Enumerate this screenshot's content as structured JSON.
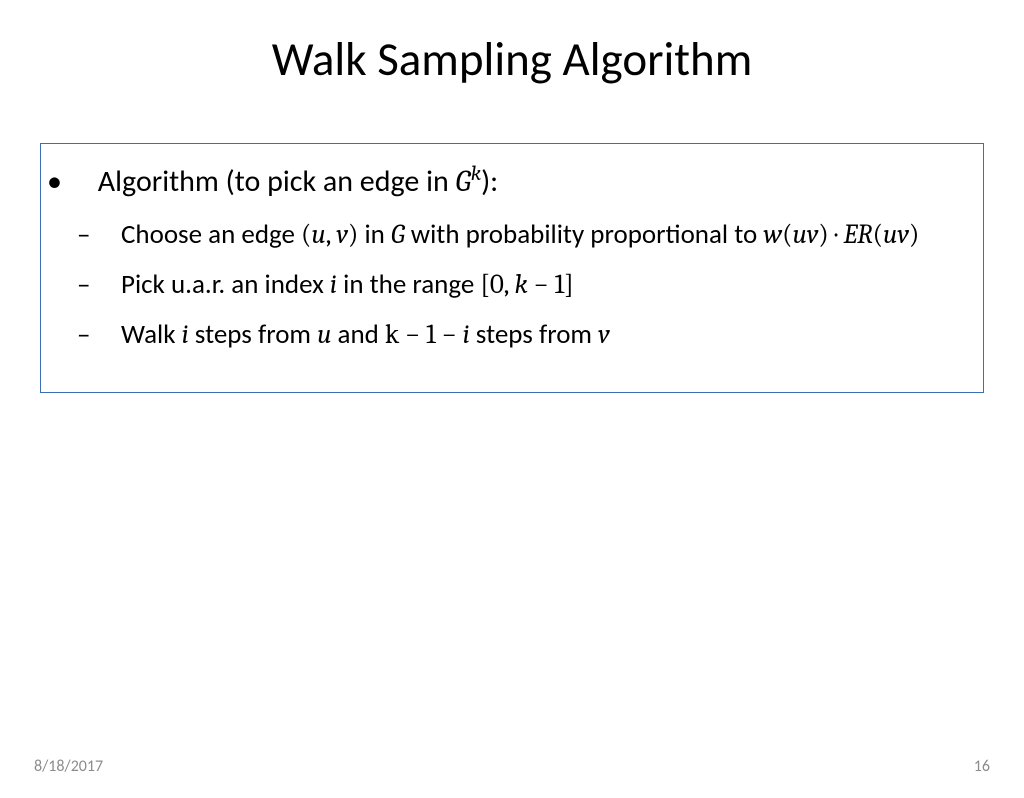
{
  "title": "Walk Sampling Algorithm",
  "main_bullet": {
    "prefix": "Algorithm (to pick an edge in ",
    "math": "G",
    "sup": "k",
    "suffix": "):"
  },
  "sub_bullets": [
    {
      "parts": [
        {
          "t": "text",
          "v": "Choose an edge "
        },
        {
          "t": "mathn",
          "v": "("
        },
        {
          "t": "math",
          "v": "u"
        },
        {
          "t": "mathn",
          "v": ", "
        },
        {
          "t": "math",
          "v": "v"
        },
        {
          "t": "mathn",
          "v": ")"
        },
        {
          "t": "text",
          "v": " in "
        },
        {
          "t": "math",
          "v": "G"
        },
        {
          "t": "text",
          "v": " with probability proportional to "
        },
        {
          "t": "math",
          "v": "w"
        },
        {
          "t": "mathn",
          "v": "("
        },
        {
          "t": "math",
          "v": "uv"
        },
        {
          "t": "mathn",
          "v": ") · "
        },
        {
          "t": "math",
          "v": "ER"
        },
        {
          "t": "mathn",
          "v": "("
        },
        {
          "t": "math",
          "v": "uv"
        },
        {
          "t": "mathn",
          "v": ")"
        }
      ]
    },
    {
      "parts": [
        {
          "t": "text",
          "v": "Pick u.a.r. an index "
        },
        {
          "t": "math",
          "v": "i"
        },
        {
          "t": "text",
          "v": " in the range "
        },
        {
          "t": "mathn",
          "v": "[0, "
        },
        {
          "t": "math",
          "v": "k"
        },
        {
          "t": "mathn",
          "v": " − 1]"
        }
      ]
    },
    {
      "parts": [
        {
          "t": "text",
          "v": "Walk "
        },
        {
          "t": "math",
          "v": "i"
        },
        {
          "t": "text",
          "v": " steps from "
        },
        {
          "t": "math",
          "v": "u"
        },
        {
          "t": "text",
          "v": " and "
        },
        {
          "t": "mathn",
          "v": "k − 1 − "
        },
        {
          "t": "math",
          "v": "i"
        },
        {
          "t": "text",
          "v": " steps from "
        },
        {
          "t": "math",
          "v": "v"
        }
      ]
    }
  ],
  "footer": {
    "date": "8/18/2017",
    "page": "16"
  }
}
